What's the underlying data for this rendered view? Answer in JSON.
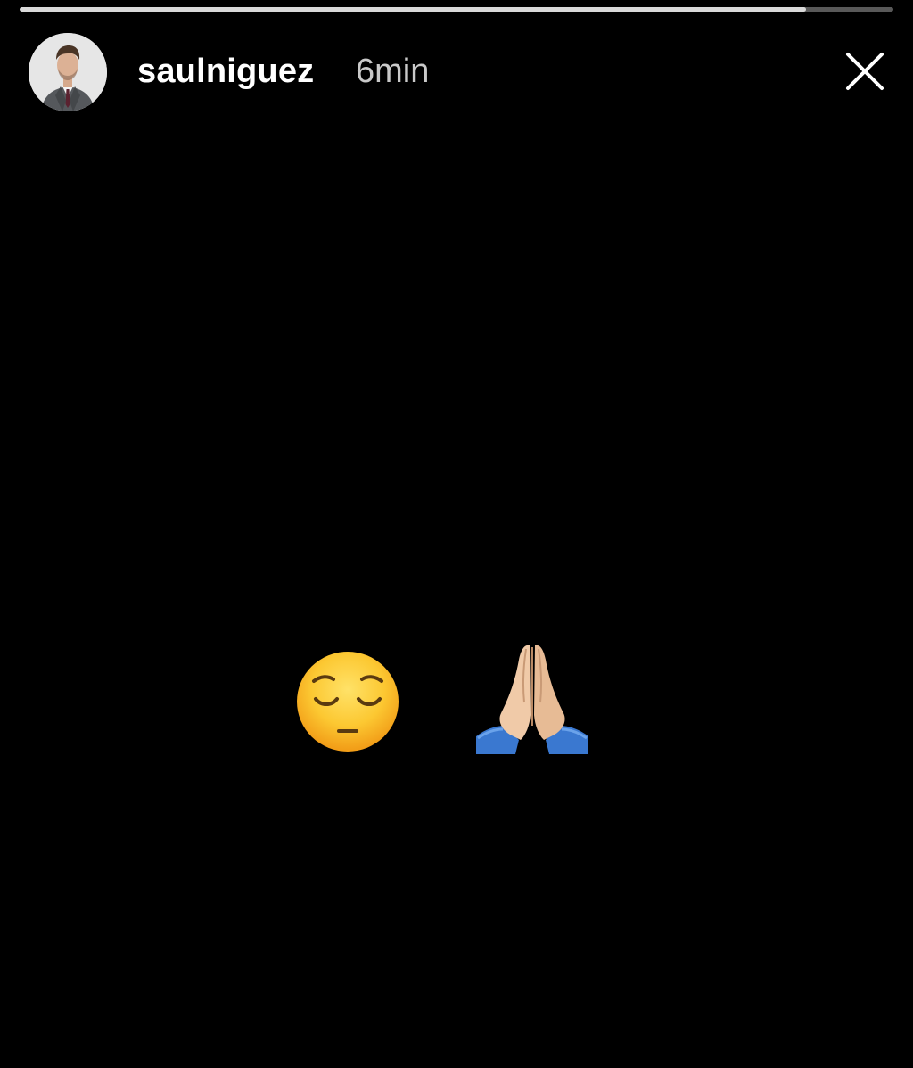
{
  "story": {
    "progress": 0.9,
    "username": "saulniguez",
    "time_ago": "6min",
    "avatar_icon": "profile-avatar",
    "close_icon": "close-icon"
  },
  "content": {
    "emojis": [
      "pensive-face",
      "folded-hands"
    ]
  },
  "colors": {
    "background": "#000000",
    "progress_track": "#5a5a5a",
    "progress_fill": "#d9d9d9",
    "text_primary": "#ffffff",
    "text_secondary": "#c9c9c9"
  }
}
